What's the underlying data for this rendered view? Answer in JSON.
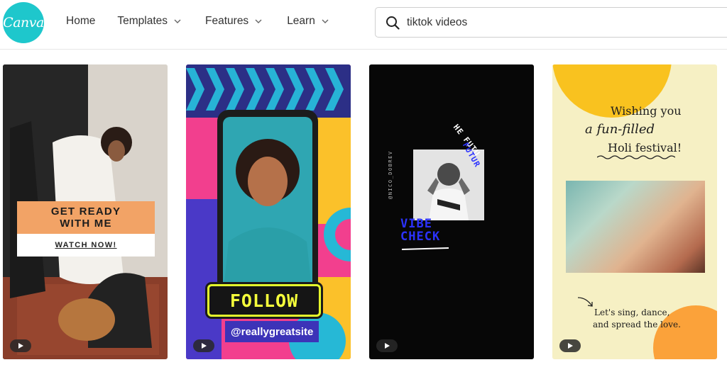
{
  "header": {
    "logo_text": "Canva",
    "nav": {
      "home": "Home",
      "templates": "Templates",
      "features": "Features",
      "learn": "Learn"
    },
    "search": {
      "value": "tiktok videos",
      "icon": "search-icon"
    }
  },
  "cards": [
    {
      "title_line1": "GET READY",
      "title_line2": "WITH ME",
      "cta": "WATCH NOW!",
      "play_icon": "play-icon"
    },
    {
      "follow": "FOLLOW",
      "handle": "@reallygreatsite",
      "play_icon": "play-icon"
    },
    {
      "arc_top": "HE FUTU",
      "arc_bottom": "FUTUR",
      "side_text": "@NICO_DOBREV",
      "vibe_line1": "VIBE",
      "vibe_line2": "CHECK",
      "play_icon": "play-icon"
    },
    {
      "line1": "Wishing you",
      "line2": "a fun-filled",
      "line3": "Holi festival!",
      "bottom_line1": "Let's sing, dance,",
      "bottom_line2": "and spread the love.",
      "play_icon": "play-icon"
    }
  ],
  "colors": {
    "brand": "#1ec7cc",
    "card2_pink": "#f23f8e",
    "card2_neon": "#f5ff3b",
    "card3_blue": "#2b32ff",
    "card4_yellow": "#f9c21f",
    "card4_orange": "#fba23a"
  }
}
